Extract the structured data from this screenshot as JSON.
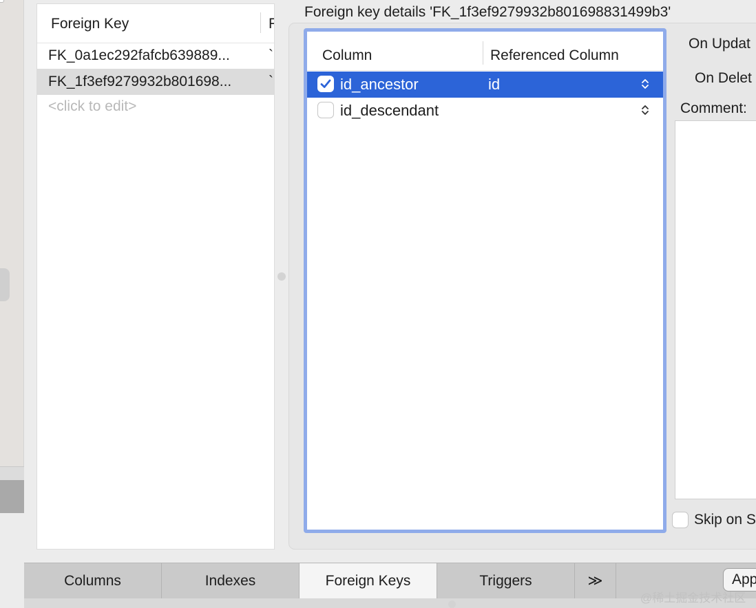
{
  "fk_list": {
    "header_name": "Foreign Key",
    "header_second": "F",
    "rows": [
      {
        "name": "FK_0a1ec292fafcb639889...",
        "second": "`"
      },
      {
        "name": "FK_1f3ef9279932b801698...",
        "second": "`"
      }
    ],
    "placeholder": "<click to edit>"
  },
  "details": {
    "title": "Foreign key details 'FK_1f3ef9279932b801698831499b3'",
    "columns_header": "Column",
    "referenced_header": "Referenced Column",
    "rows": [
      {
        "column": "id_ancestor",
        "checked": true,
        "referenced": "id"
      },
      {
        "column": "id_descendant",
        "checked": false,
        "referenced": ""
      }
    ],
    "on_update_label": "On Updat",
    "on_delete_label": "On Delet",
    "comment_label": "Comment:",
    "skip_label": "Skip on S"
  },
  "tabs": [
    "Columns",
    "Indexes",
    "Foreign Keys",
    "Triggers"
  ],
  "active_tab": "Foreign Keys",
  "more_tabs_glyph": "≫",
  "apply_label": "App",
  "watermark": "@稀土掘金技术社区",
  "colors": {
    "selection": "#2c64d8",
    "focus_ring": "#8fabea"
  }
}
